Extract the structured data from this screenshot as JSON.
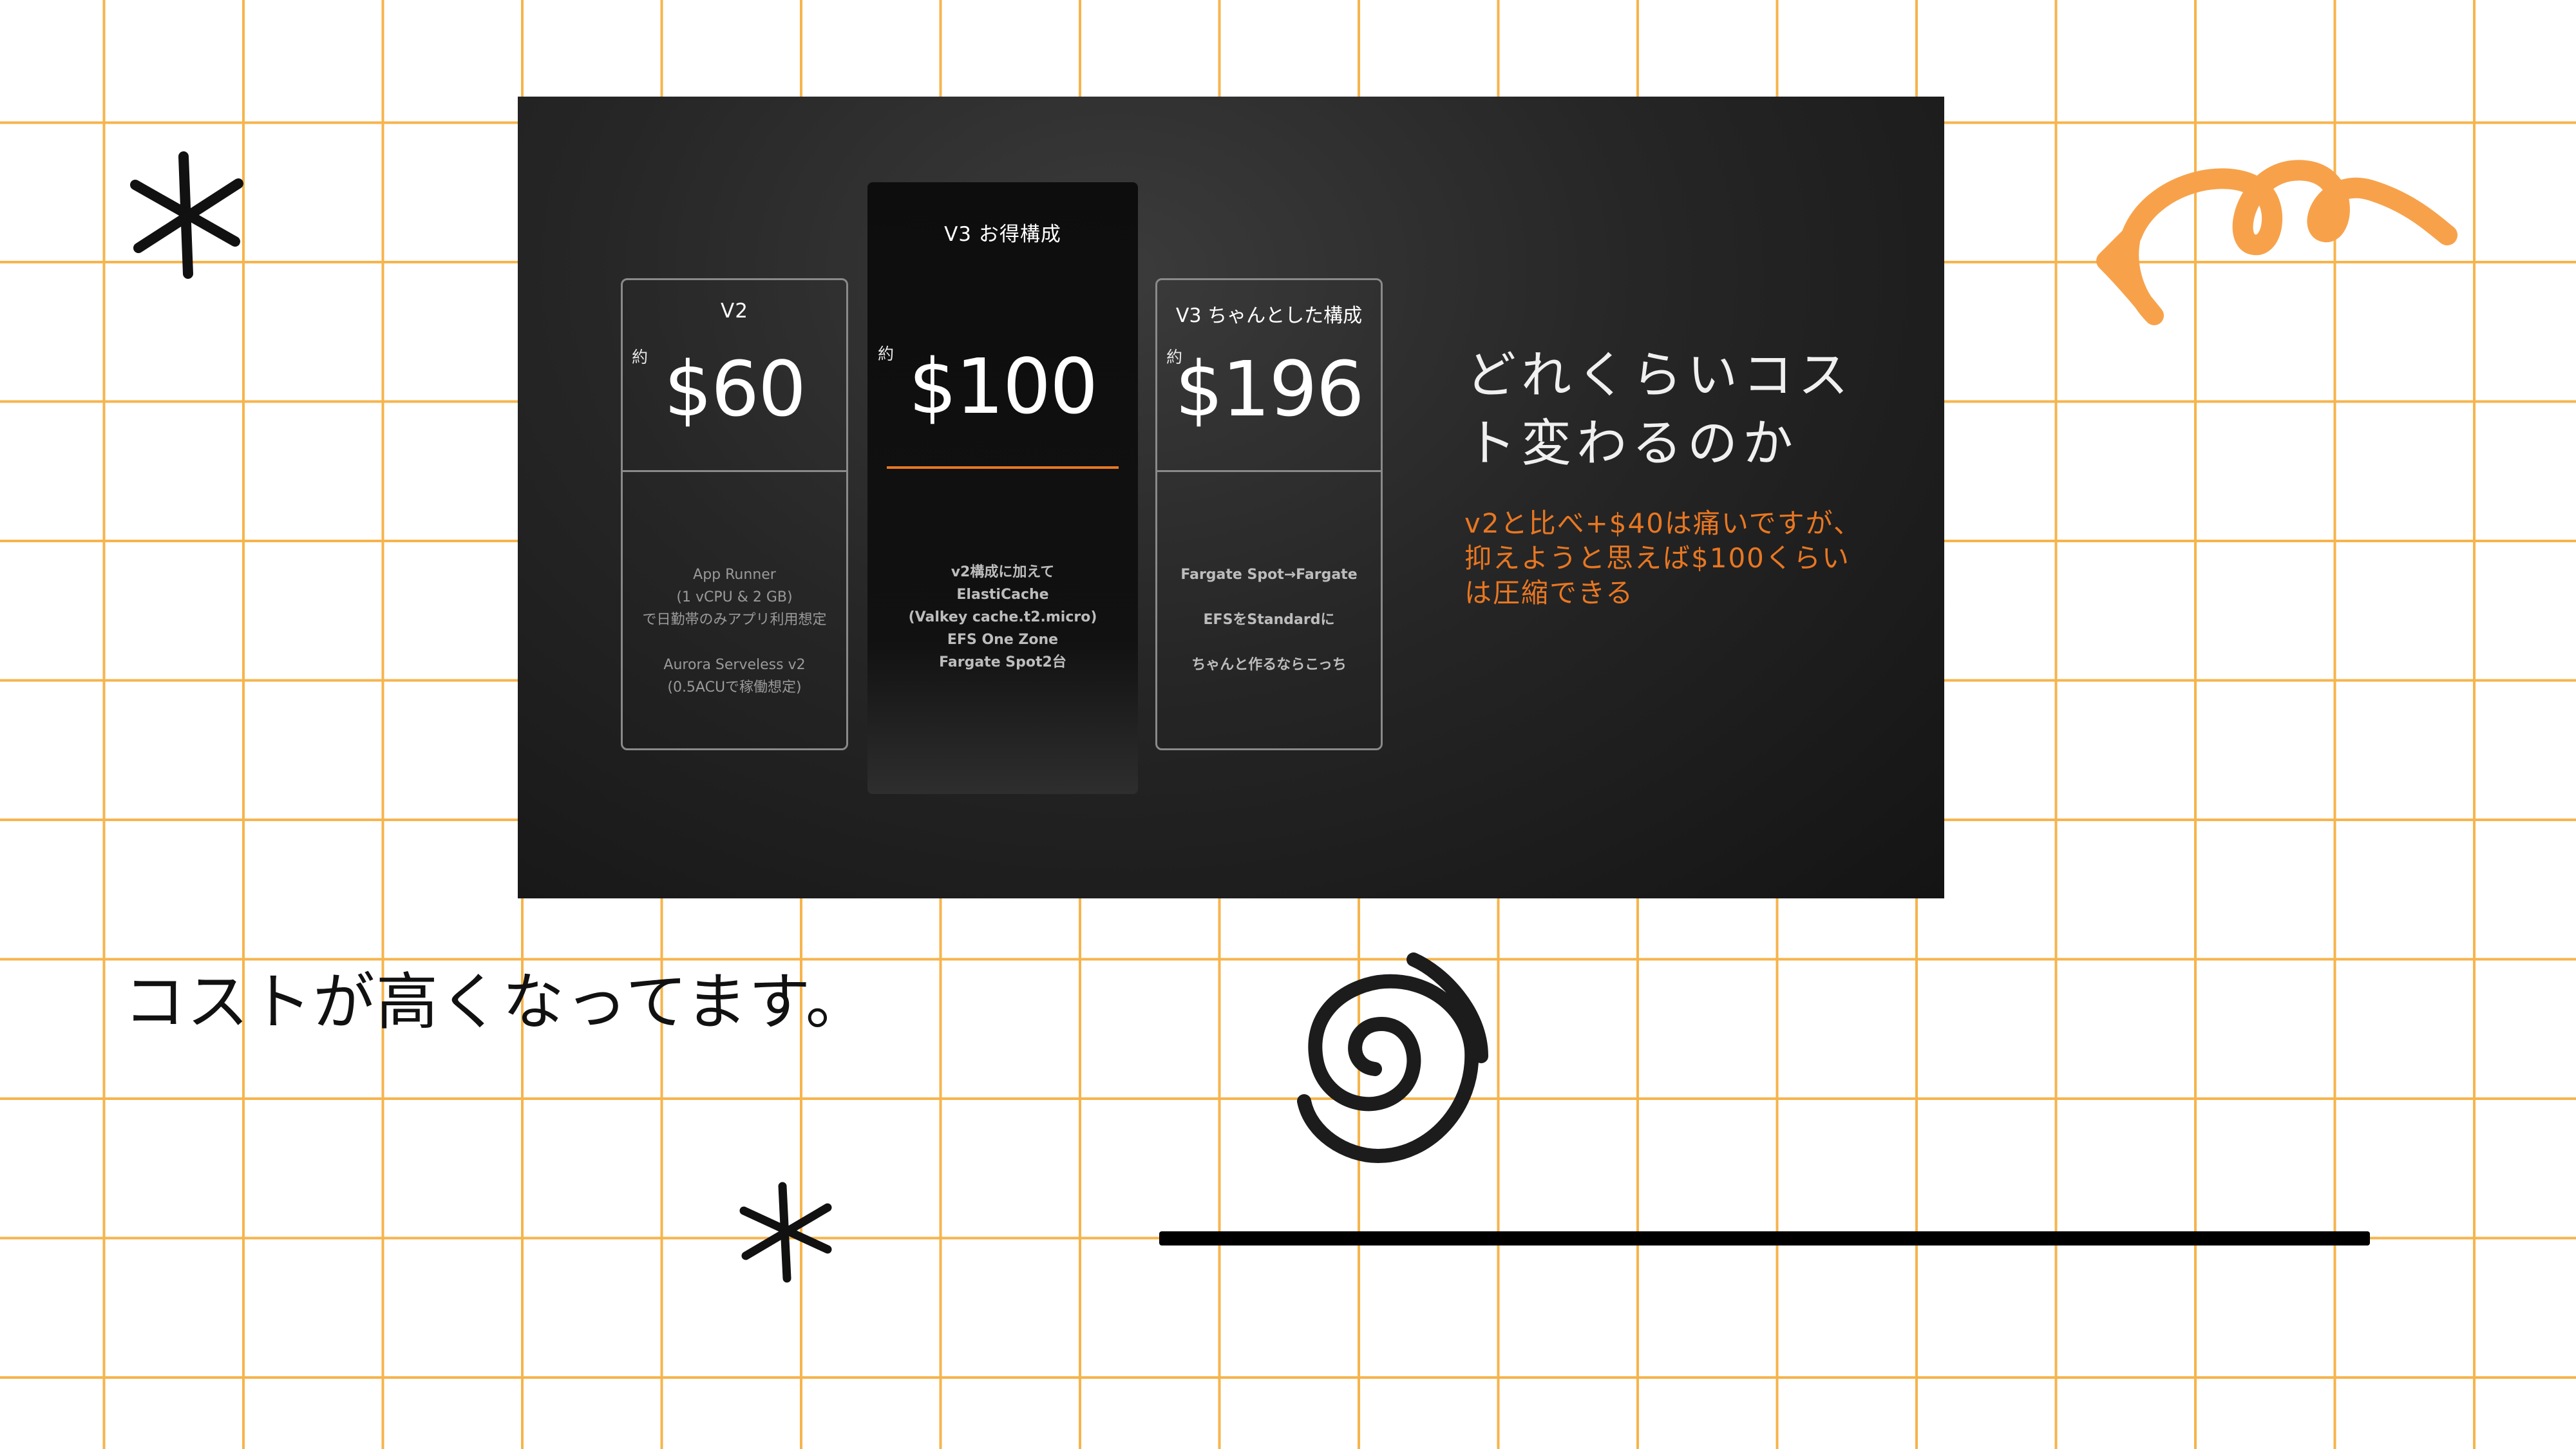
{
  "slide": {
    "heading": [
      "どれくらいコス",
      "ト変わるのか"
    ],
    "subtext": [
      "v2と比べ+$40は痛いですが、",
      "抑えようと思えば$100くらい",
      "は圧縮できる"
    ],
    "plans": [
      {
        "title": "V2",
        "prefix": "約",
        "price": "$60",
        "details": [
          "App Runner",
          "(1 vCPU & 2 GB)",
          "で日勤帯のみアプリ利用想定",
          "",
          "Aurora Serveless v2",
          "(0.5ACUで稼働想定)"
        ]
      },
      {
        "title": "V3 お得構成",
        "prefix": "約",
        "price": "$100",
        "details": [
          "v2構成に加えて",
          "ElastiCache",
          "(Valkey cache.t2.micro)",
          "EFS One Zone",
          "Fargate Spot2台"
        ]
      },
      {
        "title": "V3 ちゃんとした構成",
        "prefix": "約",
        "price": "$196",
        "details": [
          "Fargate Spot→Fargate",
          "",
          "EFSをStandardに",
          "",
          "ちゃんと作るならこっち"
        ]
      }
    ]
  },
  "caption": "コストが高くなってます。",
  "colors": {
    "accent": "#e87722",
    "grid": "#f6b44c",
    "slide_bg": "#262626",
    "doodle_orange": "#f7a24b"
  },
  "icons": [
    "asterisk-icon",
    "orange-squiggle-arrow-icon",
    "spiral-doodle-icon"
  ]
}
